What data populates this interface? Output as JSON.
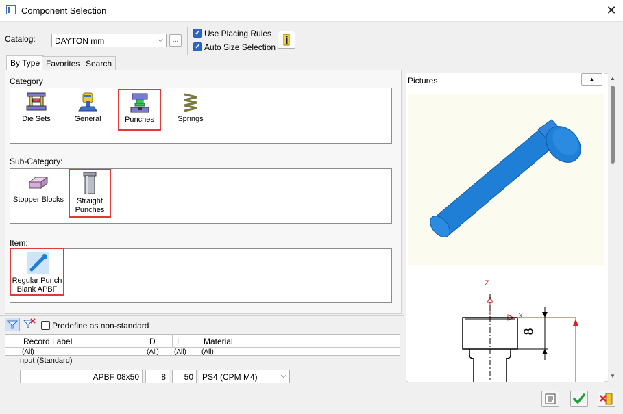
{
  "window": {
    "title": "Component Selection"
  },
  "catalog": {
    "label": "Catalog:",
    "value": "DAYTON mm",
    "browse_label": "..."
  },
  "options": {
    "use_placing_rules": {
      "label": "Use Placing Rules",
      "checked": true
    },
    "auto_size_selection": {
      "label": "Auto Size Selection",
      "checked": true
    }
  },
  "tabs": [
    {
      "label": "By Type",
      "active": true
    },
    {
      "label": "Favorites",
      "active": false
    },
    {
      "label": "Search",
      "active": false
    }
  ],
  "category": {
    "label": "Category",
    "items": [
      {
        "label": "Die Sets",
        "icon": "die-sets-icon"
      },
      {
        "label": "General",
        "icon": "general-icon"
      },
      {
        "label": "Punches",
        "icon": "punches-icon",
        "selected": true
      },
      {
        "label": "Springs",
        "icon": "springs-icon"
      }
    ]
  },
  "subcategory": {
    "label": "Sub-Category:",
    "items": [
      {
        "label": "Stopper Blocks",
        "icon": "stopper-blocks-icon"
      },
      {
        "label_line1": "Straight",
        "label_line2": "Punches",
        "icon": "straight-punches-icon",
        "selected": true
      }
    ]
  },
  "item": {
    "label": "Item:",
    "items": [
      {
        "label_line1": "Regular Punch",
        "label_line2": "Blank APBF",
        "icon": "regular-punch-icon",
        "selected": true
      }
    ]
  },
  "predefine": {
    "label": "Predefine as non-standard",
    "checked": false
  },
  "table": {
    "headers": [
      "Record Label",
      "D",
      "L",
      "Material"
    ],
    "filters": [
      "(All)",
      "(All)",
      "(All)",
      "(All)"
    ]
  },
  "input": {
    "label": "Input (Standard)",
    "record": "APBF 08x50",
    "d": "8",
    "l": "50",
    "material": "PS4 (CPM M4)"
  },
  "pictures": {
    "label": "Pictures",
    "axis_z": "Z",
    "axis_x": "X",
    "dim_label": "8"
  },
  "colors": {
    "accent": "#2a66c4",
    "highlight": "#e0393a",
    "punch_blue": "#1f7fd6",
    "dim_red": "#e02020"
  }
}
